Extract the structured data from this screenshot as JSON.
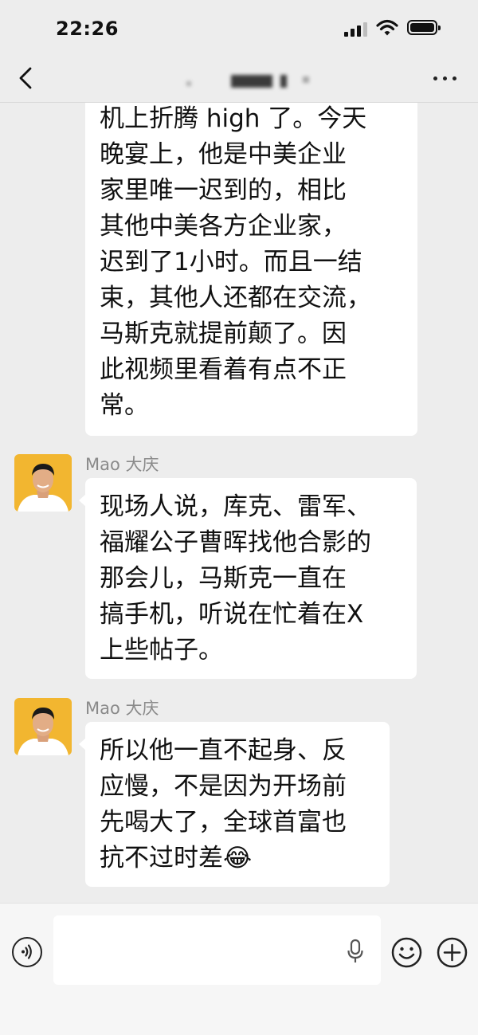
{
  "status_bar": {
    "time": "22:26"
  },
  "chat": {
    "messages": [
      {
        "sender": "",
        "lines": [
          "机上折腾 high 了。今天",
          "晚宴上，他是中美企业",
          "家里唯一迟到的，相比",
          "其他中美各方企业家，",
          "迟到了1小时。而且一结",
          "束，其他人还都在交流，",
          "马斯克就提前颠了。因",
          "此视频里看着有点不正",
          "常。"
        ]
      },
      {
        "sender": "Mao 大庆",
        "lines": [
          "现场人说，库克、雷军、",
          "福耀公子曹晖找他合影的",
          "那会儿，马斯克一直在",
          "搞手机，听说在忙着在X",
          "上些帖子。"
        ]
      },
      {
        "sender": "Mao 大庆",
        "lines": [
          "所以他一直不起身、反",
          "应慢，不是因为开场前",
          "先喝大了，全球首富也",
          "抗不过时差😂"
        ]
      }
    ]
  },
  "input_bar": {
    "placeholder": ""
  },
  "icons": {
    "back": "chevron-left-icon",
    "more": "more-dots-icon",
    "voice": "voice-icon",
    "mic": "mic-icon",
    "emoji": "emoji-icon",
    "plus": "plus-icon"
  },
  "colors": {
    "background": "#ededed",
    "bubble": "#ffffff",
    "sender_name": "#8a8a8a",
    "avatar_bg": "#f2b630"
  }
}
